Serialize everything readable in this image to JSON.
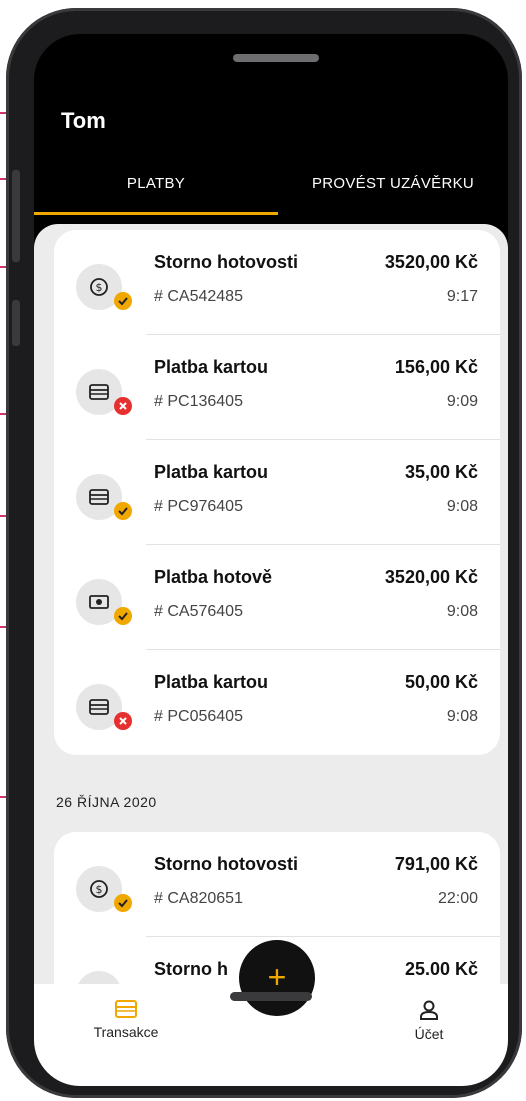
{
  "header": {
    "user_name": "Tom"
  },
  "tabs": [
    {
      "label": "PLATBY",
      "active": true
    },
    {
      "label": "PROVÉST UZÁVĚRKU",
      "active": false
    }
  ],
  "transactions_today": [
    {
      "title": "Storno hotovosti",
      "id": "# CA542485",
      "amount": "3520,00 Kč",
      "time": "9:17",
      "icon": "refund-dollar-icon",
      "status": "success"
    },
    {
      "title": "Platba kartou",
      "id": "# PC136405",
      "amount": "156,00 Kč",
      "time": "9:09",
      "icon": "credit-card-icon",
      "status": "failed"
    },
    {
      "title": "Platba kartou",
      "id": "# PC976405",
      "amount": "35,00 Kč",
      "time": "9:08",
      "icon": "credit-card-icon",
      "status": "success"
    },
    {
      "title": "Platba hotově",
      "id": "# CA576405",
      "amount": "3520,00 Kč",
      "time": "9:08",
      "icon": "cash-icon",
      "status": "success"
    },
    {
      "title": "Platba kartou",
      "id": "# PC056405",
      "amount": "50,00 Kč",
      "time": "9:08",
      "icon": "credit-card-icon",
      "status": "failed"
    }
  ],
  "date_header": "26 ŘÍJNA 2020",
  "transactions_earlier": [
    {
      "title": "Storno hotovosti",
      "id": "# CA820651",
      "amount": "791,00 Kč",
      "time": "22:00",
      "icon": "refund-dollar-icon",
      "status": "success"
    },
    {
      "title": "Storno h",
      "id": "",
      "amount": "25.00 Kč",
      "time": "",
      "icon": "refund-dollar-icon",
      "status": ""
    }
  ],
  "fab": {
    "label": "+"
  },
  "bottom_nav": [
    {
      "label": "Transakce",
      "icon": "card-icon",
      "active": true
    },
    {
      "label": "Účet",
      "icon": "person-icon",
      "active": false
    }
  ],
  "colors": {
    "accent": "#f0a800",
    "error": "#e5302f",
    "annotation": "#d6336c",
    "background": "#ececec"
  }
}
